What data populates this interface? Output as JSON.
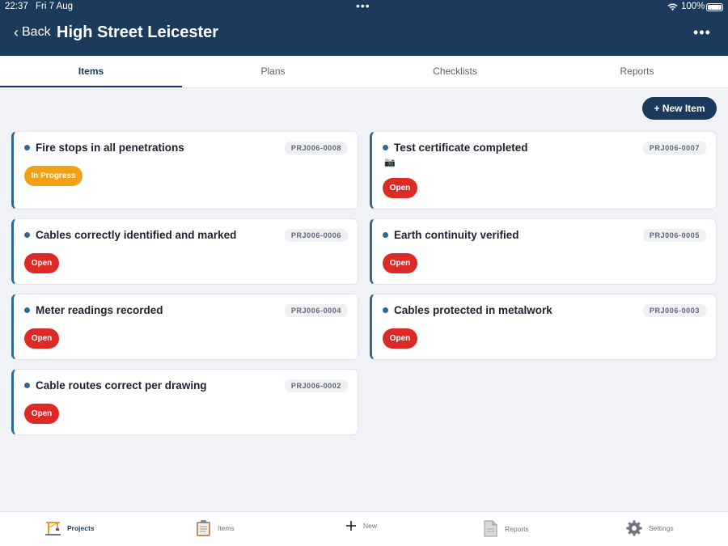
{
  "status_bar": {
    "time": "22:37",
    "date": "Fri 7 Aug",
    "battery": "100%"
  },
  "nav": {
    "back_label": "Back",
    "title": "High Street Leicester"
  },
  "tabs": [
    {
      "label": "Items"
    },
    {
      "label": "Plans"
    },
    {
      "label": "Checklists"
    },
    {
      "label": "Reports"
    }
  ],
  "actions": {
    "new_item": "+ New Item"
  },
  "items": [
    {
      "name": "Fire stops in all penetrations",
      "code": "PRJ006-0008",
      "status": "In Progress"
    },
    {
      "name": "Test certificate completed",
      "code": "PRJ006-0007",
      "status": "Open",
      "has_photo": true
    },
    {
      "name": "Cables correctly identified and marked",
      "code": "PRJ006-0006",
      "status": "Open"
    },
    {
      "name": "Earth continuity verified",
      "code": "PRJ006-0005",
      "status": "Open"
    },
    {
      "name": "Meter readings recorded",
      "code": "PRJ006-0004",
      "status": "Open"
    },
    {
      "name": "Cables protected in metalwork",
      "code": "PRJ006-0003",
      "status": "Open"
    },
    {
      "name": "Cable routes correct per drawing",
      "code": "PRJ006-0002",
      "status": "Open"
    }
  ],
  "bottom_nav": [
    {
      "label": "Projects",
      "icon": "crane-icon"
    },
    {
      "label": "Items",
      "icon": "clipboard-icon"
    },
    {
      "label": "New",
      "icon": "plus-icon"
    },
    {
      "label": "Reports",
      "icon": "document-icon"
    },
    {
      "label": "Settings",
      "icon": "gear-icon"
    }
  ],
  "colors": {
    "header": "#1b3a5c",
    "open": "#dd2a26",
    "in_progress": "#f2a116",
    "accent": "#2d6a94"
  }
}
